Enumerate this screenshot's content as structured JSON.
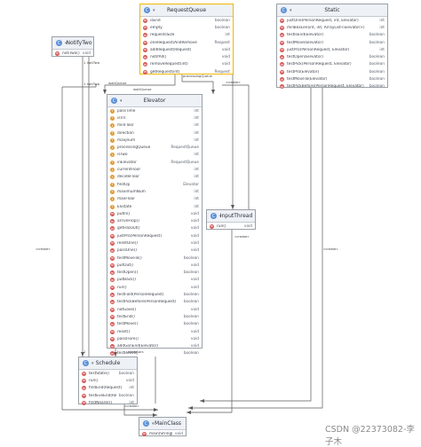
{
  "classes": {
    "request_queue": {
      "name": "RequestQueue",
      "members": [
        {
          "kind": "m",
          "name": "isEnd",
          "type": "boolean"
        },
        {
          "kind": "m",
          "name": "empty",
          "type": "boolean"
        },
        {
          "kind": "m",
          "name": "requestsSize",
          "type": "int"
        },
        {
          "kind": "m",
          "name": "oneRequest(AndRemove",
          "type": "Request"
        },
        {
          "kind": "m",
          "name": "addRequest(Request)",
          "type": "void"
        },
        {
          "kind": "m",
          "name": "notifAll()",
          "type": "void"
        },
        {
          "kind": "m",
          "name": "removeRequest(int)",
          "type": "void"
        },
        {
          "kind": "m",
          "name": "getRequest(int)",
          "type": "Request"
        }
      ]
    },
    "static": {
      "name": "Static",
      "members": [
        {
          "kind": "m",
          "name": "justOne(PersonRequest, int, Elevator)",
          "type": "int"
        },
        {
          "kind": "m",
          "name": "millBoxLen(int, int, ArrayList<Elevator>)",
          "type": "int"
        },
        {
          "kind": "m",
          "name": "testIsEnd(Elevator)",
          "type": "boolean"
        },
        {
          "kind": "m",
          "name": "testMove(Elevator)",
          "type": "boolean"
        },
        {
          "kind": "m",
          "name": "justPro(PersonRequest, Elevator)",
          "type": "int"
        },
        {
          "kind": "m",
          "name": "testOpen(Elevator)",
          "type": "boolean"
        },
        {
          "kind": "m",
          "name": "testPick(PersonRequest, Elevator)",
          "type": "boolean"
        },
        {
          "kind": "m",
          "name": "testPro(Elevator)",
          "type": "boolean"
        },
        {
          "kind": "m",
          "name": "testMoveTo(Elevator)",
          "type": "boolean"
        },
        {
          "kind": "m",
          "name": "testPickBefore(PersonRequest, Elevator)",
          "type": "boolean"
        }
      ]
    },
    "notify_two": {
      "name": "NotifyTwo",
      "members": [
        {
          "kind": "m",
          "name": "notiTwo()",
          "type": "void"
        }
      ]
    },
    "elevator": {
      "name": "Elevator",
      "members": [
        {
          "kind": "f",
          "name": "passTime",
          "type": "int"
        },
        {
          "kind": "f",
          "name": "isTrs",
          "type": "int"
        },
        {
          "kind": "f",
          "name": "minFloor",
          "type": "int"
        },
        {
          "kind": "f",
          "name": "direction",
          "type": "int"
        },
        {
          "kind": "f",
          "name": "maxjnum",
          "type": "int"
        },
        {
          "kind": "f",
          "name": "processingQueue",
          "type": "RequestQueue"
        },
        {
          "kind": "f",
          "name": "isTwo",
          "type": "int"
        },
        {
          "kind": "f",
          "name": "inElevator",
          "type": "RequestQueue"
        },
        {
          "kind": "f",
          "name": "currentFloor",
          "type": "int"
        },
        {
          "kind": "f",
          "name": "decideFloor",
          "type": "int"
        },
        {
          "kind": "f",
          "name": "findOp",
          "type": "Elevator"
        },
        {
          "kind": "f",
          "name": "maximumNum",
          "type": "int"
        },
        {
          "kind": "f",
          "name": "maxFloor",
          "type": "int"
        },
        {
          "kind": "f",
          "name": "ESstate",
          "type": "int"
        },
        {
          "kind": "m",
          "name": "putIn()",
          "type": "void"
        },
        {
          "kind": "m",
          "name": "arriveFlop()",
          "type": "void"
        },
        {
          "kind": "m",
          "name": "getIsIoOut()",
          "type": "void"
        },
        {
          "kind": "m",
          "name": "justPro(PersonRequest)",
          "type": "void"
        },
        {
          "kind": "m",
          "name": "resetOne()",
          "type": "void"
        },
        {
          "kind": "m",
          "name": "passOne()",
          "type": "void"
        },
        {
          "kind": "m",
          "name": "testMoveTo()",
          "type": "boolean"
        },
        {
          "kind": "m",
          "name": "putOut()",
          "type": "void"
        },
        {
          "kind": "m",
          "name": "testOpen()",
          "type": "boolean"
        },
        {
          "kind": "m",
          "name": "putBack()",
          "type": "void"
        },
        {
          "kind": "m",
          "name": "run()",
          "type": "void"
        },
        {
          "kind": "m",
          "name": "testFold(PersonRequest)",
          "type": "boolean"
        },
        {
          "kind": "m",
          "name": "testPickBefore(PersonRequest)",
          "type": "boolean"
        },
        {
          "kind": "m",
          "name": "notGoes()",
          "type": "void"
        },
        {
          "kind": "m",
          "name": "testEnd()",
          "type": "boolean"
        },
        {
          "kind": "m",
          "name": "testMove()",
          "type": "boolean"
        },
        {
          "kind": "m",
          "name": "reset()",
          "type": "void"
        },
        {
          "kind": "m",
          "name": "passFlore()",
          "type": "void"
        },
        {
          "kind": "m",
          "name": "addGonEnd(Elevator)",
          "type": "void"
        },
        {
          "kind": "m",
          "name": "testReset()",
          "type": "boolean"
        }
      ]
    },
    "input_thread": {
      "name": "InputThread",
      "members": [
        {
          "kind": "m",
          "name": "run()",
          "type": "void"
        }
      ]
    },
    "schedule": {
      "name": "Schedule",
      "members": [
        {
          "kind": "m",
          "name": "testState()",
          "type": "boolean"
        },
        {
          "kind": "m",
          "name": "run()",
          "type": "void"
        },
        {
          "kind": "m",
          "name": "findEnd(Request)",
          "type": "int"
        },
        {
          "kind": "m",
          "name": "testEveEnd(Request)",
          "type": "boolean"
        },
        {
          "kind": "m",
          "name": "findNearer()",
          "type": "int"
        }
      ]
    },
    "main_class": {
      "name": "MainClass",
      "members": [
        {
          "kind": "m",
          "name": "main(String[])",
          "type": "void"
        }
      ]
    }
  },
  "edge_labels": {
    "one_notify": "1 notiTwo",
    "one_notify_b": "1 notiTwo",
    "processing_queue": "processingQueue",
    "wait_queue": "waitQueue",
    "wait_queue_b": "waitQueue",
    "creates": "«create»",
    "one": "1",
    "elevators": "elevators"
  },
  "watermark": "CSDN @22373082-李子木",
  "colors": {
    "class_icon": "#5b8fd6",
    "method_icon": "#d65a5a",
    "field_icon": "#e39b39",
    "selected_border": "#f2b705",
    "edge": "#5a5a5a"
  },
  "icons": {
    "class": "class-c-icon",
    "method": "method-m-icon",
    "field": "field-f-icon",
    "toggle": "collapse-toggle-icon"
  }
}
